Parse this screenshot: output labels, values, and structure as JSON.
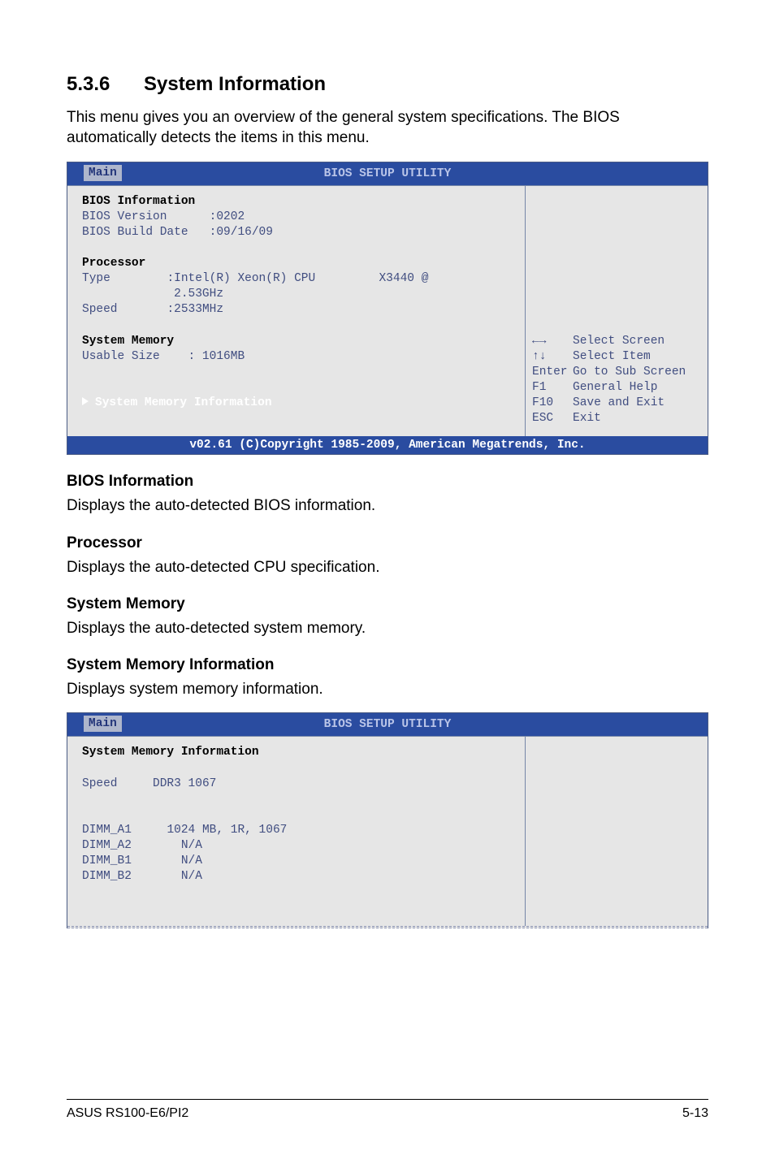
{
  "section": {
    "number": "5.3.6",
    "title": "System Information"
  },
  "intro": "This menu gives you an overview of the general system specifications. The BIOS automatically detects the items in this menu.",
  "bios1": {
    "setup_title": "BIOS SETUP UTILITY",
    "tab": "Main",
    "lines": {
      "bios_info_header": "BIOS Information",
      "bios_version_label": "BIOS Version",
      "bios_version_value": ":0202",
      "bios_date_label": "BIOS Build Date",
      "bios_date_value": ":09/16/09",
      "proc_header": "Processor",
      "proc_type_label": "Type",
      "proc_type_value": ":Intel(R) Xeon(R) CPU         X3440 @",
      "proc_type_value2": "2.53GHz",
      "proc_speed_label": "Speed",
      "proc_speed_value": ":2533MHz",
      "mem_header": "System Memory",
      "mem_usable_label": "Usable Size",
      "mem_usable_value": ": 1016MB",
      "submenu": "System Memory Information"
    },
    "help": {
      "l1k": "←→",
      "l1v": "Select Screen",
      "l2k": "↑↓",
      "l2v": "Select Item",
      "l3k": "Enter",
      "l3v": "Go to Sub Screen",
      "l4k": "F1",
      "l4v": "General Help",
      "l5k": "F10",
      "l5v": "Save and Exit",
      "l6k": "ESC",
      "l6v": "Exit"
    },
    "footer": "v02.61 (C)Copyright 1985-2009, American Megatrends, Inc."
  },
  "subs": {
    "bios_info_h": "BIOS Information",
    "bios_info_t": "Displays the auto-detected BIOS information.",
    "proc_h": "Processor",
    "proc_t": "Displays the auto-detected CPU specification.",
    "mem_h": "System Memory",
    "mem_t": "Displays the auto-detected system memory.",
    "meminfo_h": "System Memory Information",
    "meminfo_t": "Displays system memory information."
  },
  "bios2": {
    "setup_title": "BIOS SETUP UTILITY",
    "tab": "Main",
    "sys_mem_info_header": "System Memory Information",
    "speed_label": "Speed",
    "speed_value": "DDR3 1067",
    "dimm_a1_label": "DIMM_A1",
    "dimm_a1_value": "1024 MB, 1R, 1067",
    "dimm_a2_label": "DIMM_A2",
    "dimm_a2_value": "N/A",
    "dimm_b1_label": "DIMM_B1",
    "dimm_b1_value": "N/A",
    "dimm_b2_label": "DIMM_B2",
    "dimm_b2_value": "N/A"
  },
  "footer": {
    "left": "ASUS RS100-E6/PI2",
    "right": "5-13"
  }
}
